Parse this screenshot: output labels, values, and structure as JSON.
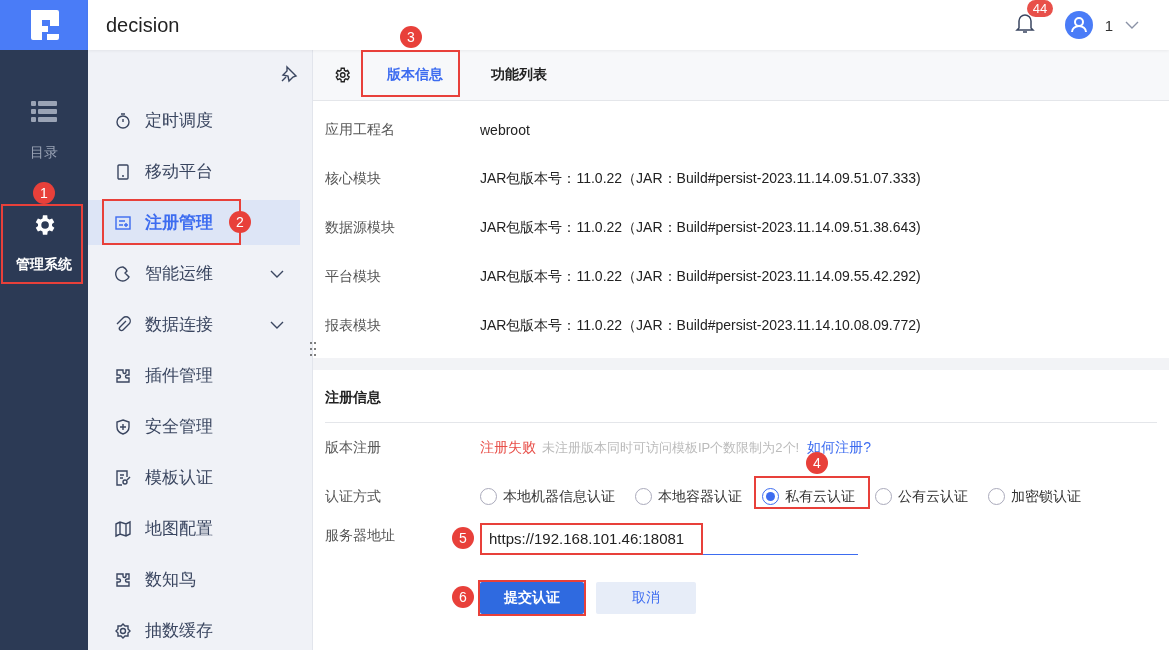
{
  "header": {
    "title": "decision",
    "notifications": "44",
    "user": "1"
  },
  "rail": [
    {
      "label": "目录",
      "selected": false,
      "highlighted": false
    },
    {
      "label": "管理系统",
      "selected": true,
      "highlighted": true,
      "callout": "1"
    }
  ],
  "sidebar": {
    "items": [
      {
        "label": "定时调度",
        "selected": false,
        "highlighted": false
      },
      {
        "label": "移动平台",
        "selected": false,
        "highlighted": false
      },
      {
        "label": "注册管理",
        "selected": true,
        "highlighted": true,
        "callout": "2"
      },
      {
        "label": "智能运维",
        "selected": false,
        "highlighted": false,
        "expanded": false
      },
      {
        "label": "数据连接",
        "selected": false,
        "highlighted": false,
        "expanded": false
      },
      {
        "label": "插件管理",
        "selected": false,
        "highlighted": false
      },
      {
        "label": "安全管理",
        "selected": false,
        "highlighted": false
      },
      {
        "label": "模板认证",
        "selected": false,
        "highlighted": false
      },
      {
        "label": "地图配置",
        "selected": false,
        "highlighted": false
      },
      {
        "label": "数知鸟",
        "selected": false,
        "highlighted": false
      },
      {
        "label": "抽数缓存",
        "selected": false,
        "highlighted": false
      }
    ]
  },
  "tabs": [
    {
      "label": "版本信息",
      "selected": true,
      "highlighted": true,
      "callout": "3"
    },
    {
      "label": "功能列表",
      "selected": false,
      "highlighted": false
    }
  ],
  "info_rows": [
    {
      "label": "应用工程名",
      "value": "webroot"
    },
    {
      "label": "核心模块",
      "value": "JAR包版本号：11.0.22（JAR：Build#persist-2023.11.14.09.51.07.333)"
    },
    {
      "label": "数据源模块",
      "value": "JAR包版本号：11.0.22（JAR：Build#persist-2023.11.14.09.51.38.643)"
    },
    {
      "label": "平台模块",
      "value": "JAR包版本号：11.0.22（JAR：Build#persist-2023.11.14.09.55.42.292)"
    },
    {
      "label": "报表模块",
      "value": "JAR包版本号：11.0.22（JAR：Build#persist-2023.11.14.10.08.09.772)"
    }
  ],
  "registration": {
    "title": "注册信息",
    "version": {
      "label": "版本注册",
      "status": "注册失败",
      "note": "未注册版本同时可访问模板IP个数限制为2个!",
      "link": "如何注册?"
    },
    "auth": {
      "label": "认证方式",
      "options": [
        {
          "label": "本地机器信息认证",
          "selected": false,
          "highlighted": false
        },
        {
          "label": "本地容器认证",
          "selected": false,
          "highlighted": false
        },
        {
          "label": "私有云认证",
          "selected": true,
          "highlighted": true,
          "callout": "4"
        },
        {
          "label": "公有云认证",
          "selected": false,
          "highlighted": false
        },
        {
          "label": "加密锁认证",
          "selected": false,
          "highlighted": false
        }
      ]
    },
    "server": {
      "label": "服务器地址",
      "value": "https://192.168.101.46:18081",
      "highlighted": true,
      "callout": "5"
    },
    "buttons": [
      {
        "label": "提交认证",
        "kind": "primary",
        "highlighted": true,
        "callout": "6"
      },
      {
        "label": "取消",
        "kind": "secondary",
        "highlighted": false
      }
    ]
  }
}
